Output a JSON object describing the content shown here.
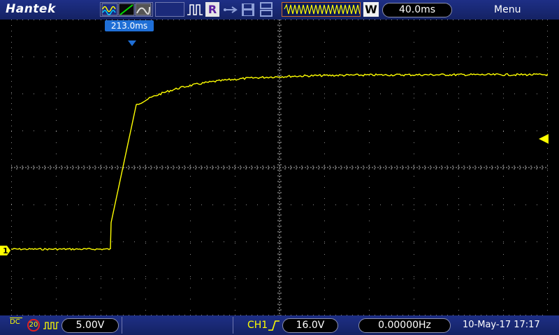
{
  "brand": "Hantek",
  "top": {
    "run_state": "R",
    "timebase": "40.0ms",
    "trigger_mode_letter": "W",
    "menu_label": "Menu"
  },
  "cursor": {
    "label": "213.0ms"
  },
  "channel": {
    "marker": "1",
    "coupling": "DC",
    "probe": "20",
    "volts_div": "5.00V"
  },
  "trigger": {
    "source": "CH1",
    "level": "16.0V"
  },
  "frequency": "0.00000Hz",
  "datetime": "10-May-17 17:17",
  "colors": {
    "trace": "#ffff00",
    "grid": "#9a9a9a",
    "bar": "#1a2a78",
    "cursor": "#1f6fd6"
  }
}
